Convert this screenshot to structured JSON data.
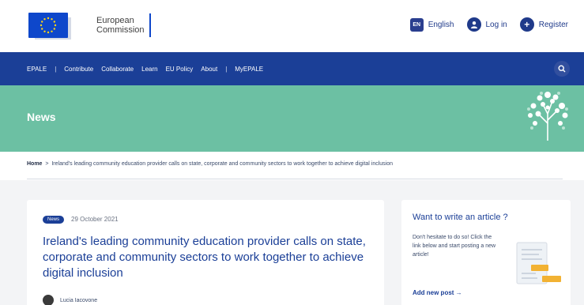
{
  "header": {
    "org_line1": "European",
    "org_line2": "Commission",
    "language_code": "EN",
    "language_label": "English",
    "login_label": "Log in",
    "register_label": "Register"
  },
  "nav": {
    "items": [
      "EPALE",
      "Contribute",
      "Collaborate",
      "Learn",
      "EU Policy",
      "About",
      "MyEPALE"
    ]
  },
  "banner": {
    "title": "News"
  },
  "breadcrumb": {
    "home": "Home",
    "current": "Ireland's leading community education provider calls on state, corporate and community sectors to work together to achieve digital inclusion"
  },
  "article": {
    "badge": "News",
    "date": "29 October 2021",
    "title": "Ireland's leading community education provider calls on state, corporate and community sectors to work together to achieve digital inclusion",
    "author": "Lucia Iacovone"
  },
  "sidebar": {
    "title": "Want to write an article ?",
    "text": "Don't hesitate to do so! Click the link below and start posting a new article!",
    "link": "Add new post →"
  },
  "colors": {
    "brand_blue": "#1b3f97",
    "banner_green": "#6cc0a3"
  }
}
